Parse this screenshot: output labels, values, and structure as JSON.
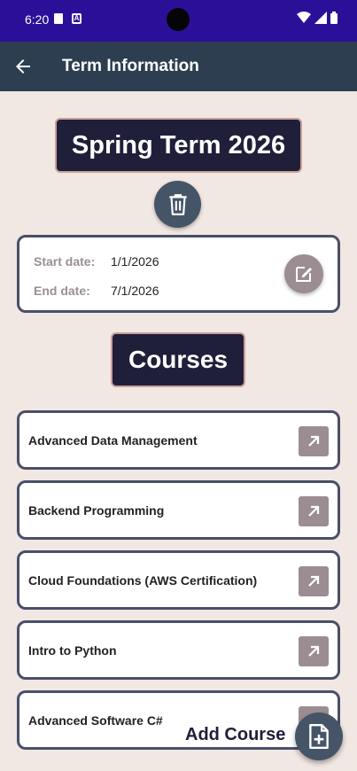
{
  "status_bar": {
    "time": "6:20",
    "icons": [
      "sd-card-icon",
      "a-notification-icon",
      "wifi-icon",
      "signal-icon",
      "battery-icon"
    ]
  },
  "app_bar": {
    "title": "Term Information",
    "back_icon": "arrow-left-icon",
    "background": "#2c3e50"
  },
  "term": {
    "title": "Spring Term 2026",
    "delete_icon": "trash-icon",
    "start_label": "Start date:",
    "start_value": "1/1/2026",
    "end_label": "End date:",
    "end_value": "7/1/2026",
    "edit_icon": "edit-icon"
  },
  "courses": {
    "heading": "Courses",
    "items": [
      {
        "name": "Advanced Data Management"
      },
      {
        "name": "Backend Programming"
      },
      {
        "name": "Cloud Foundations (AWS Certification)"
      },
      {
        "name": "Intro to Python"
      },
      {
        "name": "Advanced Software C#"
      }
    ],
    "open_icon": "open-arrow-icon"
  },
  "add_course": {
    "label": "Add Course",
    "icon": "add-file-icon"
  },
  "colors": {
    "status_bar": "#2c0f99",
    "page_bg": "#f1e7e3",
    "title_box": "#1f1f3a",
    "card_border": "#4a4f6a",
    "button_muted": "#9c8d92",
    "button_dark": "#465467"
  }
}
